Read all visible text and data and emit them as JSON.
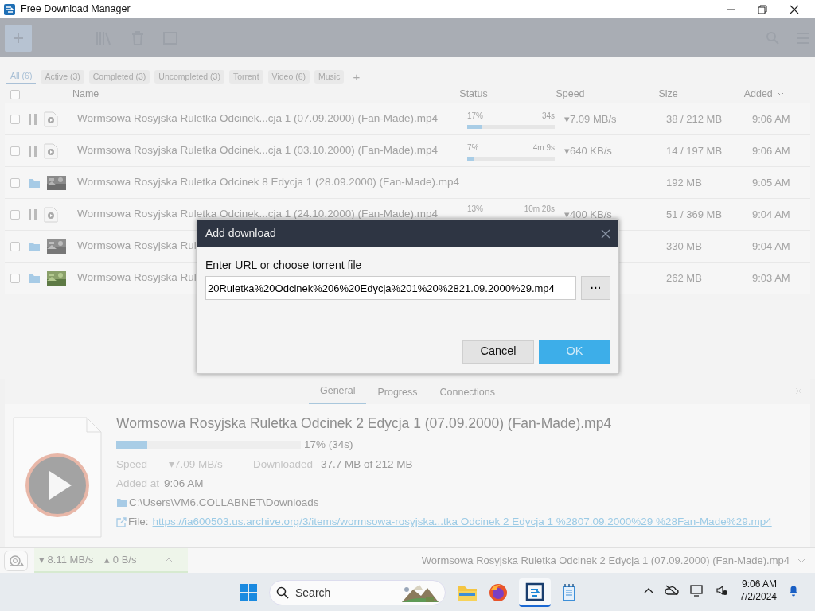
{
  "window": {
    "title": "Free Download Manager"
  },
  "filters": [
    {
      "label": "All (6)",
      "selected": true
    },
    {
      "label": "Active (3)",
      "selected": false
    },
    {
      "label": "Completed (3)",
      "selected": false
    },
    {
      "label": "Uncompleted (3)",
      "selected": false
    },
    {
      "label": "Torrent",
      "selected": false
    },
    {
      "label": "Video (6)",
      "selected": false
    },
    {
      "label": "Music",
      "selected": false
    }
  ],
  "add_filter": "+",
  "columns": [
    {
      "label": "Name"
    },
    {
      "label": "Status"
    },
    {
      "label": "Speed"
    },
    {
      "label": "Size"
    },
    {
      "label": "Added",
      "sorted": true
    }
  ],
  "select_all": {
    "checked": false
  },
  "rows": [
    {
      "kind": "active",
      "checked": false,
      "name": "Wormsowa Rosyjska Ruletka Odcinek...cja 1 (07.09.2000) (Fan-Made).mp4",
      "percent": "17%",
      "eta": "34s",
      "level": 0.17,
      "speed": "▾7.09 MB/s",
      "size": "38 / 212 MB",
      "added": "9:06 AM"
    },
    {
      "kind": "active",
      "checked": false,
      "name": "Wormsowa Rosyjska Ruletka Odcinek...cja 1 (03.10.2000) (Fan-Made).mp4",
      "percent": "7%",
      "eta": "4m 9s",
      "level": 0.07,
      "speed": "▾640 KB/s",
      "size": "14 / 197 MB",
      "added": "9:06 AM"
    },
    {
      "kind": "completed",
      "checked": false,
      "name": "Wormsowa Rosyjska Ruletka Odcinek 8 Edycja 1 (28.09.2000) (Fan-Made).mp4",
      "size": "192 MB",
      "added": "9:05 AM"
    },
    {
      "kind": "active",
      "checked": false,
      "name": "Wormsowa Rosyjska Ruletka Odcinek...cja 1 (24.10.2000) (Fan-Made).mp4",
      "percent": "13%",
      "eta": "10m 28s",
      "speed": "▾400 KB/s",
      "size": "51 / 369 MB",
      "added": "9:04 AM"
    },
    {
      "kind": "completed",
      "checked": false,
      "name": "Wormsowa Rosyjska Rul",
      "size": "330 MB",
      "added": "9:04 AM"
    },
    {
      "kind": "completed",
      "checked": false,
      "name": "Wormsowa Rosyjska Rul",
      "size": "262 MB",
      "added": "9:03 AM"
    }
  ],
  "dialog": {
    "title": "Add download",
    "label": "Enter URL or choose torrent file",
    "value": "20Ruletka%20Odcinek%206%20Edycja%201%20%2821.09.2000%29.mp4",
    "browse": "···",
    "buttons": [
      {
        "label": "Cancel",
        "kind": "secondary"
      },
      {
        "label": "OK",
        "kind": "primary"
      }
    ]
  },
  "details": {
    "tabs": [
      {
        "label": "General",
        "selected": true
      },
      {
        "label": "Progress",
        "selected": false
      },
      {
        "label": "Connections",
        "selected": false
      }
    ],
    "title": "Wormsowa Rosyjska Ruletka Odcinek 2 Edycja 1 (07.09.2000) (Fan-Made).mp4",
    "level": 0.17,
    "progress": "17% (34s)",
    "speed_label": "Speed",
    "speed": "▾7.09 MB/s",
    "downloaded_label": "Downloaded",
    "downloaded": "37.7 MB of 212 MB",
    "added_label": "Added at",
    "added": "9:06 AM",
    "folder": "C:\\Users\\VM6.COLLABNET\\Downloads",
    "file_label": "File:",
    "file_url": "https://ia600503.us.archive.org/3/items/wormsowa-rosyjska...tka Odcinek 2 Edycja 1 %2807.09.2000%29 %28Fan-Made%29.mp4"
  },
  "status_bar": {
    "down": "▾ 8.11 MB/s",
    "up": "▴ 0 B/s",
    "current": "Wormsowa Rosyjska Ruletka Odcinek 2 Edycja 1 (07.09.2000) (Fan-Made).mp4"
  },
  "taskbar": {
    "search": "Search",
    "time": "9:06 AM",
    "date": "7/2/2024"
  }
}
